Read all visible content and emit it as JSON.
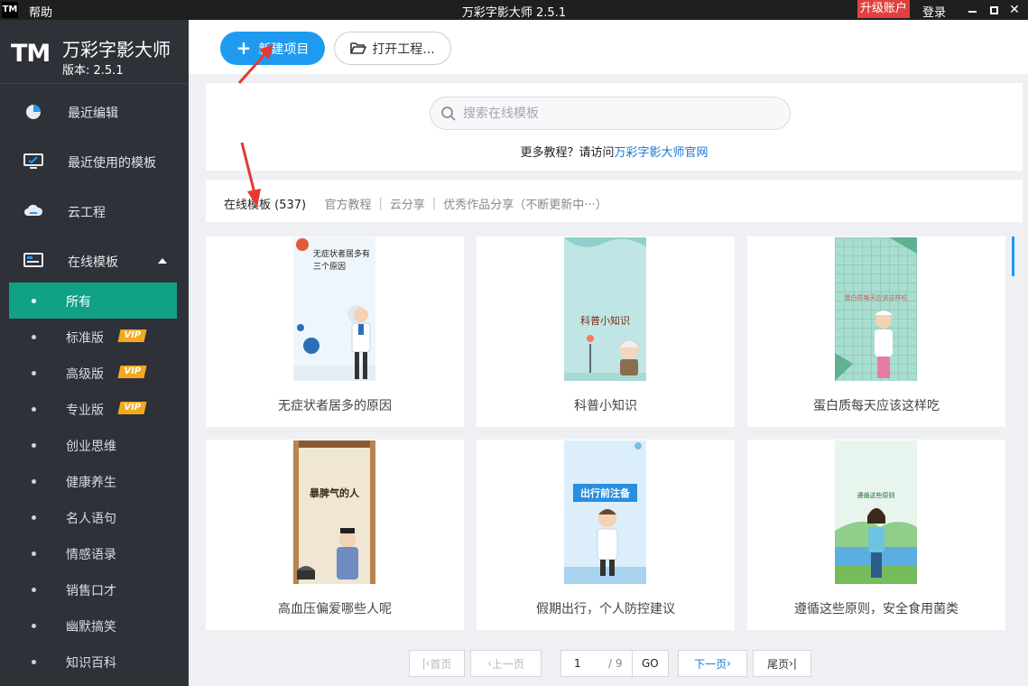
{
  "titlebar": {
    "logo": "TM",
    "help": "帮助",
    "title": "万彩字影大师 2.5.1",
    "upgrade": "升级账户",
    "login": "登录"
  },
  "sidebar": {
    "logo": "TM",
    "app_name": "万彩字影大师",
    "version": "版本: 2.5.1",
    "items": [
      {
        "label": "最近编辑",
        "icon": "pie-chart-icon"
      },
      {
        "label": "最近使用的模板",
        "icon": "monitor-icon"
      },
      {
        "label": "云工程",
        "icon": "cloud-icon"
      },
      {
        "label": "在线模板",
        "icon": "template-icon"
      }
    ],
    "sub_items": [
      {
        "label": "所有",
        "vip": ""
      },
      {
        "label": "标准版",
        "vip": "VIP"
      },
      {
        "label": "高级版",
        "vip": "VIP"
      },
      {
        "label": "专业版",
        "vip": "VIP"
      },
      {
        "label": "创业思维",
        "vip": ""
      },
      {
        "label": "健康养生",
        "vip": ""
      },
      {
        "label": "名人语句",
        "vip": ""
      },
      {
        "label": "情感语录",
        "vip": ""
      },
      {
        "label": "销售口才",
        "vip": ""
      },
      {
        "label": "幽默搞笑",
        "vip": ""
      },
      {
        "label": "知识百科",
        "vip": ""
      }
    ]
  },
  "toolbar": {
    "new_project": "新建项目",
    "open_project": "打开工程..."
  },
  "search": {
    "placeholder": "搜索在线模板",
    "more_prefix": "更多教程？请访问",
    "more_link": "万彩字影大师官网"
  },
  "tabs": {
    "online": "在线模板 (537)",
    "official": "官方教程",
    "cloud": "云分享",
    "excellent": "优秀作品分享（不断更新中···）"
  },
  "templates": [
    {
      "caption": "无症状者居多的原因",
      "thumb_text": "无症状者居多有三个原因"
    },
    {
      "caption": "科普小知识",
      "thumb_text": "科普小知识"
    },
    {
      "caption": "蛋白质每天应该这样吃",
      "thumb_text": "蛋白质每天应该这样吃"
    },
    {
      "caption": "高血压偏爱哪些人呢",
      "thumb_text": "暴脾气的人"
    },
    {
      "caption": "假期出行，个人防控建议",
      "thumb_text": "出行前注备"
    },
    {
      "caption": "遵循这些原则，安全食用菌类",
      "thumb_text": "遵循这些原则"
    }
  ],
  "pager": {
    "first": "首页",
    "prev": "上一页",
    "current": "1",
    "total": "/ 9",
    "go": "GO",
    "next": "下一页",
    "last": "尾页"
  },
  "colors": {
    "accent": "#1e9bf0",
    "active_menu": "#11a286",
    "sidebar_bg": "#2e3138",
    "vip": "#f2a91d",
    "upgrade": "#e14040",
    "annotation_arrow": "#e53935"
  }
}
